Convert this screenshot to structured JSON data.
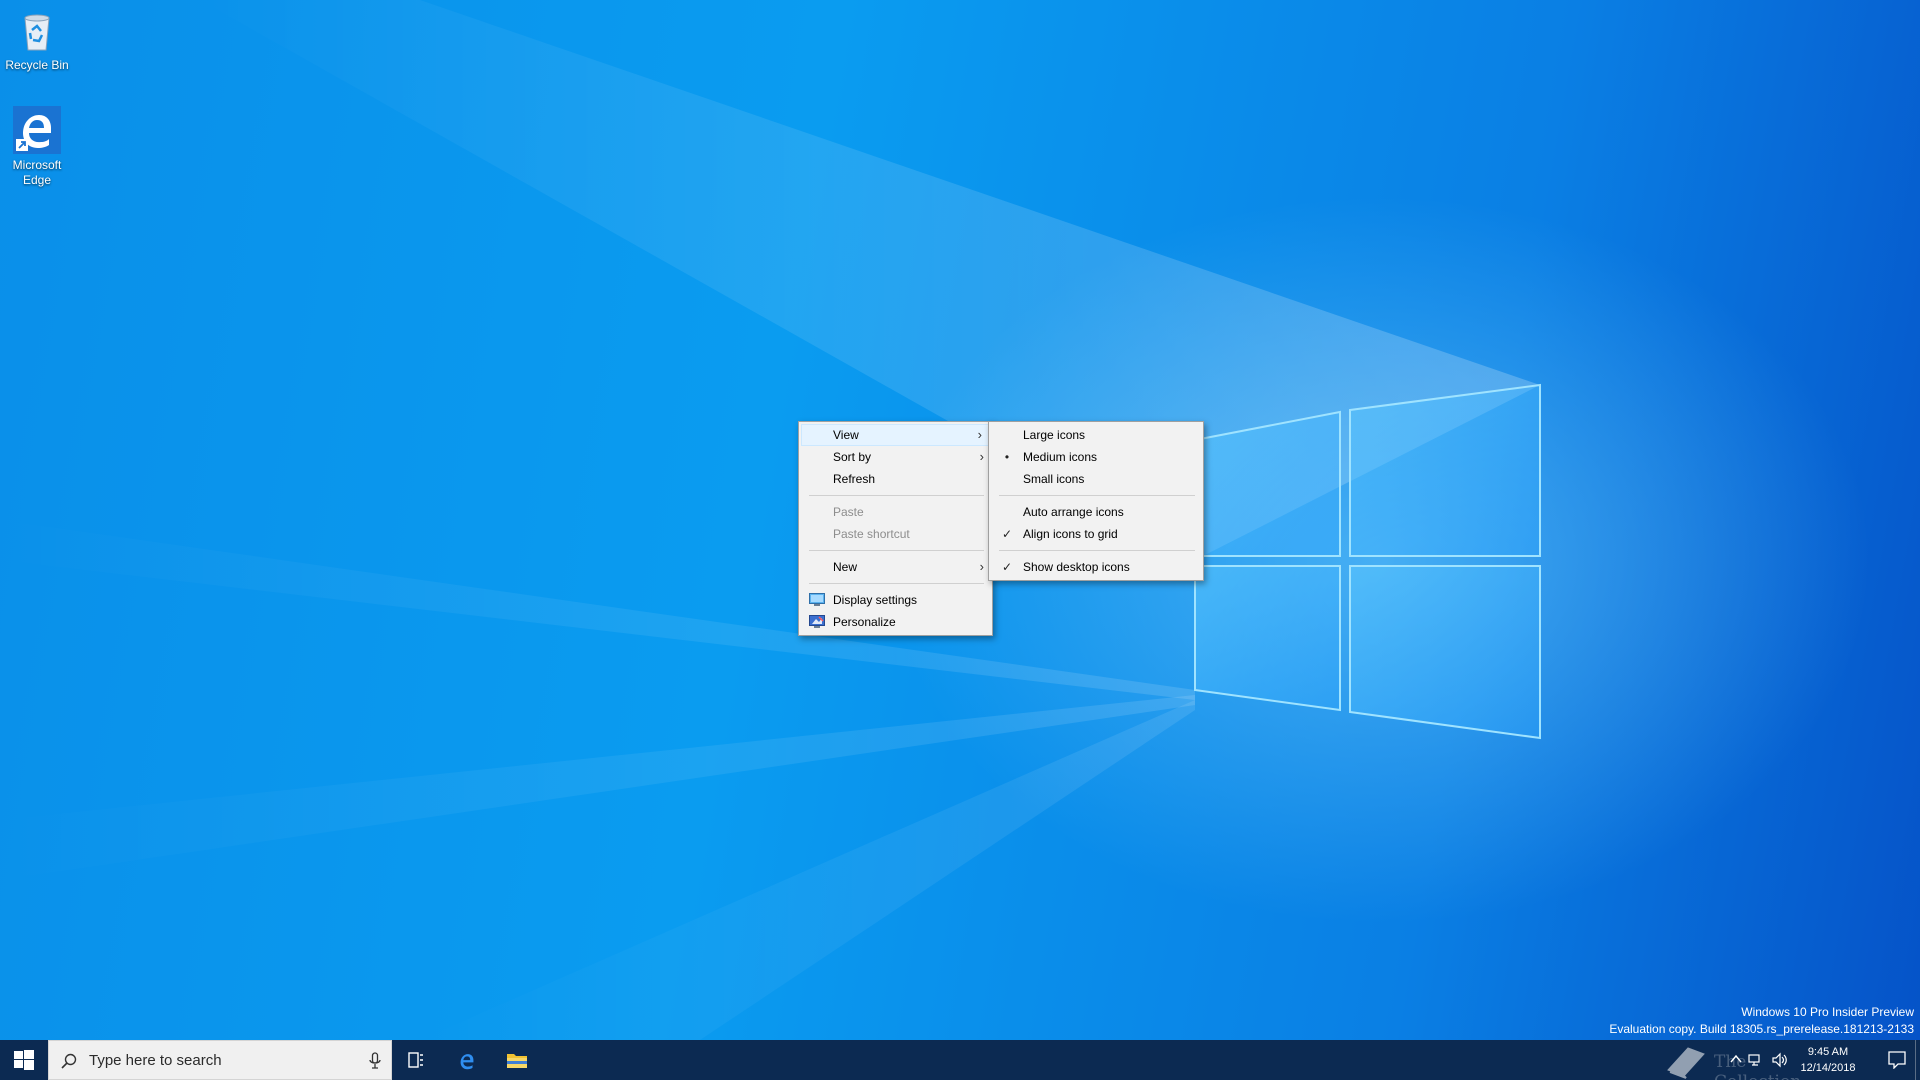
{
  "desktop": {
    "icons": [
      {
        "label": "Recycle Bin",
        "icon": "recycle-bin-icon"
      },
      {
        "label": "Microsoft Edge",
        "icon": "edge-icon"
      }
    ]
  },
  "context_menu": {
    "items": [
      {
        "label": "View",
        "submenu": true,
        "highlighted": true
      },
      {
        "label": "Sort by",
        "submenu": true
      },
      {
        "label": "Refresh"
      },
      {
        "label": "Paste",
        "disabled": true
      },
      {
        "label": "Paste shortcut",
        "disabled": true
      },
      {
        "label": "New",
        "submenu": true
      },
      {
        "label": "Display settings",
        "icon": "display-settings-icon"
      },
      {
        "label": "Personalize",
        "icon": "personalize-icon"
      }
    ],
    "submenu_arrow": "›"
  },
  "view_submenu": {
    "items": [
      {
        "label": "Large icons"
      },
      {
        "label": "Medium icons",
        "mark": "•"
      },
      {
        "label": "Small icons"
      },
      {
        "label": "Auto arrange icons"
      },
      {
        "label": "Align icons to grid",
        "mark": "✓"
      },
      {
        "label": "Show desktop icons",
        "mark": "✓"
      }
    ]
  },
  "watermark": {
    "line1": "Windows 10 Pro Insider Preview",
    "line2": "Evaluation copy. Build 18305.rs_prerelease.181213-2133"
  },
  "taskbar": {
    "search_placeholder": "Type here to search",
    "tray_overlay_text": "The Collection Book",
    "clock_time": "9:45 AM",
    "clock_date": "12/14/2018"
  },
  "colors": {
    "taskbar": "#0c2a52",
    "menu_bg": "#f2f2f2",
    "menu_highlight": "#e5f3ff",
    "wallpaper_blue": "#0a8fe9"
  }
}
